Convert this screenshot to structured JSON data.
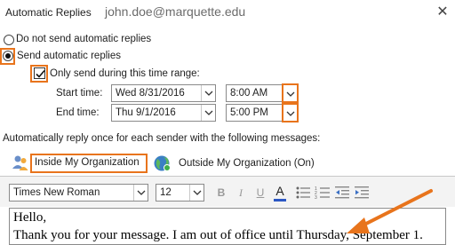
{
  "window": {
    "title": "Automatic Replies",
    "account": "john.doe@marquette.edu",
    "close_glyph": "✕"
  },
  "options": {
    "do_not_send": {
      "label": "Do not send automatic replies",
      "selected": false
    },
    "send": {
      "label": "Send automatic replies",
      "selected": true
    },
    "time_range": {
      "label": "Only send during this time range:",
      "checked": true
    }
  },
  "schedule": {
    "start": {
      "label": "Start time:",
      "date": "Wed 8/31/2016",
      "time": "8:00 AM"
    },
    "end": {
      "label": "End time:",
      "date": "Thu 9/1/2016",
      "time": "5:00 PM"
    }
  },
  "instructions": "Automatically reply once for each sender with the following messages:",
  "tabs": [
    {
      "label": "Inside My Organization",
      "icon": "people-icon",
      "selected": true
    },
    {
      "label": "Outside My Organization (On)",
      "icon": "globe-icon",
      "selected": false
    }
  ],
  "toolbar": {
    "font_family": "Times New Roman",
    "font_size": "12",
    "bold": "B",
    "italic": "I",
    "underline": "U",
    "font_color": "A"
  },
  "message": {
    "line1": "Hello,",
    "line2": "Thank you for your message. I am out of office until Thursday, September 1."
  },
  "colors": {
    "highlight": "#e8741c",
    "toolbar_bg": "#f3f3f3",
    "font_color_underline": "#2b57c4"
  }
}
